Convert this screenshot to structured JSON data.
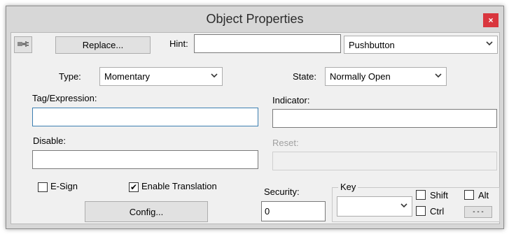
{
  "window": {
    "title": "Object Properties",
    "close_label": "×"
  },
  "toolbar": {
    "icon": "plug-icon",
    "replace_label": "Replace...",
    "hint_label": "Hint:",
    "hint_value": "",
    "object_type": "Pushbutton"
  },
  "type": {
    "label": "Type:",
    "value": "Momentary"
  },
  "state": {
    "label": "State:",
    "value": "Normally Open"
  },
  "tag": {
    "label": "Tag/Expression:",
    "value": ""
  },
  "indicator": {
    "label": "Indicator:",
    "value": ""
  },
  "disable": {
    "label": "Disable:",
    "value": ""
  },
  "reset": {
    "label": "Reset:",
    "value": ""
  },
  "esign": {
    "label": "E-Sign",
    "checked": false
  },
  "translation": {
    "label": "Enable Translation",
    "checked": true,
    "check_glyph": "✔"
  },
  "config": {
    "label": "Config..."
  },
  "security": {
    "label": "Security:",
    "value": "0"
  },
  "key": {
    "group_label": "Key",
    "value": "",
    "shift_label": "Shift",
    "ctrl_label": "Ctrl",
    "alt_label": "Alt",
    "more_label": "- - -"
  },
  "chevron": "❯"
}
